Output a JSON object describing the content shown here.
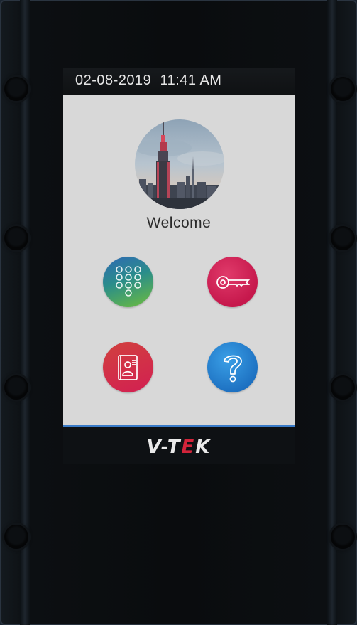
{
  "status_bar": {
    "date": "02-08-2019",
    "time": "11:41 AM"
  },
  "welcome_screen": {
    "greeting": "Welcome",
    "buttons": [
      {
        "id": "keypad",
        "icon": "keypad-icon"
      },
      {
        "id": "key",
        "icon": "key-icon"
      },
      {
        "id": "contacts",
        "icon": "contact-card-icon"
      },
      {
        "id": "help",
        "icon": "question-icon"
      }
    ]
  },
  "brand": {
    "logo_text": "V-TEK",
    "logo_prefix": "V-T",
    "logo_accent": "E",
    "logo_suffix": "K",
    "accent_color": "#d3243a"
  }
}
